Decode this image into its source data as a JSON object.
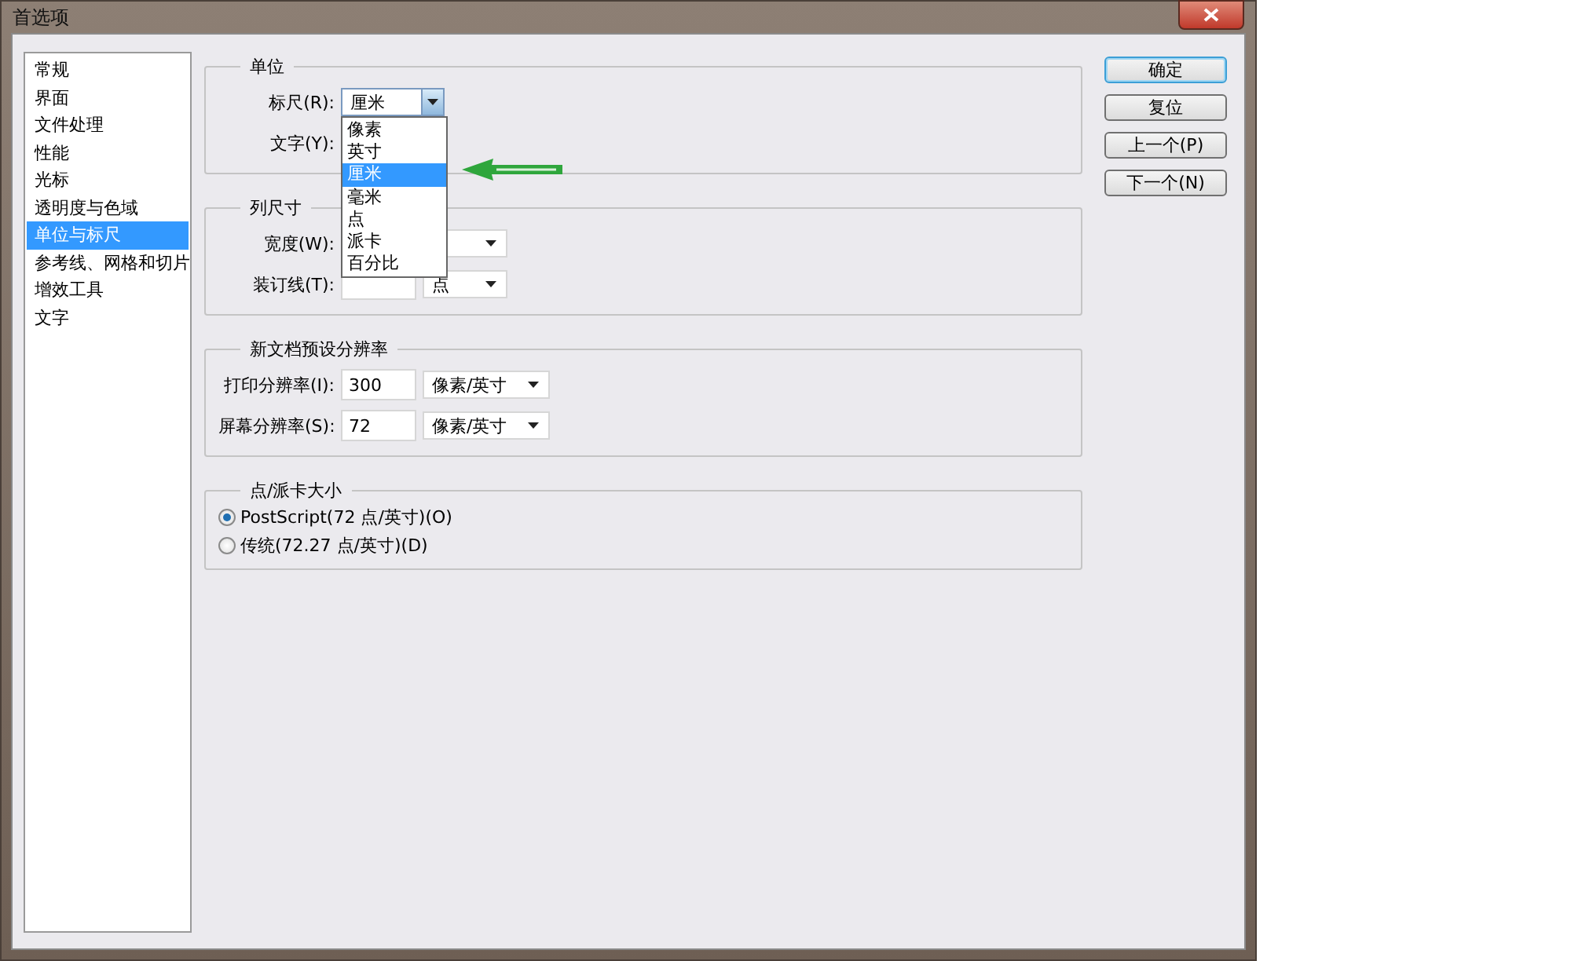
{
  "window": {
    "title": "首选项"
  },
  "sidebar": {
    "items": [
      {
        "label": "常规",
        "selected": false
      },
      {
        "label": "界面",
        "selected": false
      },
      {
        "label": "文件处理",
        "selected": false
      },
      {
        "label": "性能",
        "selected": false
      },
      {
        "label": "光标",
        "selected": false
      },
      {
        "label": "透明度与色域",
        "selected": false
      },
      {
        "label": "单位与标尺",
        "selected": true
      },
      {
        "label": "参考线、网格和切片",
        "selected": false
      },
      {
        "label": "增效工具",
        "selected": false
      },
      {
        "label": "文字",
        "selected": false
      }
    ]
  },
  "units": {
    "title": "单位",
    "ruler": {
      "label": "标尺(R):",
      "value": "厘米",
      "expanded": true,
      "options": [
        {
          "label": "像素",
          "selected": false
        },
        {
          "label": "英寸",
          "selected": false
        },
        {
          "label": "厘米",
          "selected": true
        },
        {
          "label": "毫米",
          "selected": false
        },
        {
          "label": "点",
          "selected": false
        },
        {
          "label": "派卡",
          "selected": false
        },
        {
          "label": "百分比",
          "selected": false
        }
      ]
    },
    "type": {
      "label": "文字(Y):"
    }
  },
  "column_size": {
    "title": "列尺寸",
    "width": {
      "label": "宽度(W):"
    },
    "gutter": {
      "label": "装订线(T):",
      "unit": "点"
    }
  },
  "resolution": {
    "title": "新文档预设分辨率",
    "rows": [
      {
        "label": "打印分辨率(I):",
        "value": "300",
        "unit": "像素/英寸"
      },
      {
        "label": "屏幕分辨率(S):",
        "value": "72",
        "unit": "像素/英寸"
      }
    ]
  },
  "point_size": {
    "title": "点/派卡大小",
    "options": [
      {
        "label": "PostScript(72 点/英寸)(O)",
        "selected": true
      },
      {
        "label": "传统(72.27 点/英寸)(D)",
        "selected": false
      }
    ]
  },
  "buttons": [
    {
      "label": "确定",
      "default": true
    },
    {
      "label": "复位",
      "default": false
    },
    {
      "label": "上一个(P)",
      "default": false
    },
    {
      "label": "下一个(N)",
      "default": false
    }
  ]
}
